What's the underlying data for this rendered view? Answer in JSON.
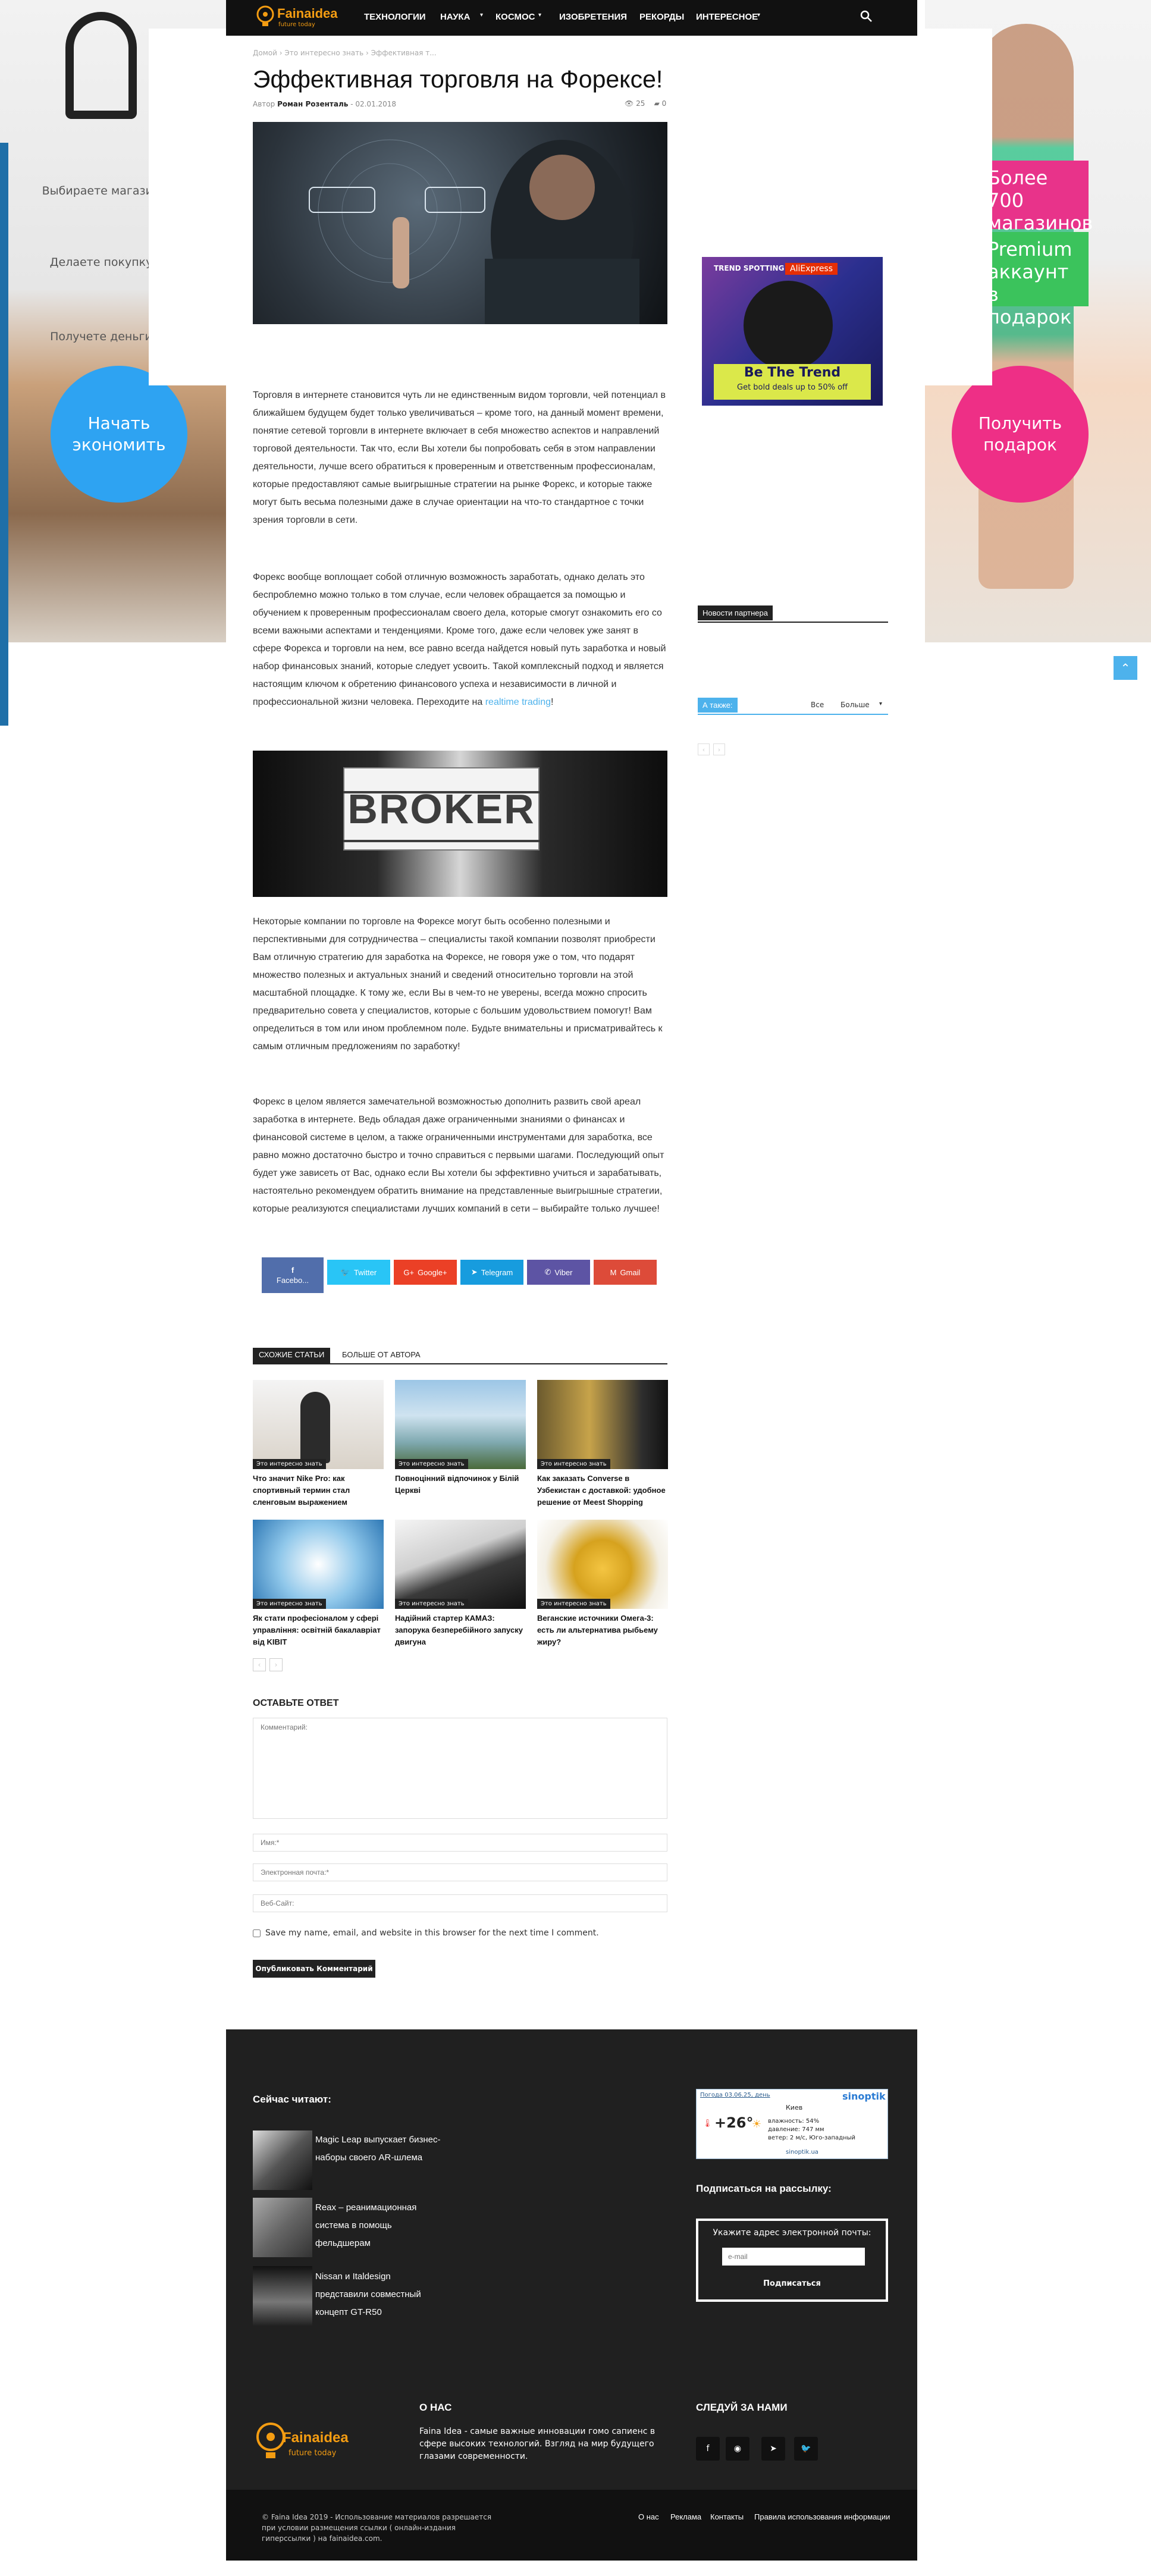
{
  "skin": {
    "left_steps": [
      "Выбираете магазин",
      "Делаете покупку",
      "Получете деньги"
    ],
    "left_button": "Начать экономить",
    "right_button": "Получить подарок",
    "right_promo_1": "Более 700 магазинов",
    "right_promo_2": "Premium аккаунт в подарок"
  },
  "nav": {
    "logo": "Fainaidea",
    "logo_sub": "future today",
    "items": [
      "ТЕХНОЛОГИИ",
      "НАУКА",
      "КОСМОС",
      "ИЗОБРЕТЕНИЯ",
      "РЕКОРДЫ",
      "ИНТЕРЕСНОЕ"
    ],
    "search_icon": "search-icon"
  },
  "article": {
    "breadcrumb": [
      "Домой",
      "Это интересно знать",
      "Эффективная т..."
    ],
    "title": "Эффективная торговля на Форексе!",
    "author_label": "Автор",
    "author": "Роман Розенталь",
    "date": "02.01.2018",
    "views": "25",
    "comments": "0",
    "p1": "Торговля в интернете становится чуть ли не единственным видом торговли, чей потенциал в ближайшем будущем будет только увеличиваться – кроме того, на данный момент времени, понятие сетевой торговли в интернете включает в себя множество аспектов и направлений торговой деятельности. Так что, если Вы хотели бы попробовать себя в этом направлении деятельности, лучше всего обратиться к проверенным и ответственным профессионалам, которые предоставляют самые выигрышные стратегии на рынке Форекс, и которые также могут быть весьма полезными даже в случае ориентации на что-то стандартное с точки зрения торговли в сети.",
    "p2": "Форекс вообще воплощает собой отличную возможность заработать, однако делать это беспроблемно можно только в том случае, если человек обращается за помощью и обучением к проверенным профессионалам своего дела, которые смогут ознакомить его со всеми важными аспектами и тенденциями. Кроме того, даже если человек уже занят в сфере Форекса и торговли на нем, все равно всегда найдется новый путь заработка и новый набор финансовых знаний, которые следует усвоить. Такой комплексный подход и является настоящим ключом к обретению финансового успеха и независимости в личной и профессиональной жизни человека. Переходите на",
    "p2_link": "realtime trading",
    "p2_end": "!",
    "broker_text": "BROKER",
    "p3": "Некоторые компании по торговле на Форексе могут быть особенно полезными и перспективными для сотрудничества – специалисты такой компании позволят приобрести Вам отличную стратегию для заработка на Форексе, не говоря уже о том, что подарят множество полезных и актуальных знаний и сведений относительно торговли на этой масштабной площадке. К тому же, если Вы в чем-то не уверены, всегда можно спросить предварительно совета у специалистов, которые с большим удовольствием помогут! Вам определиться в том или ином проблемном поле. Будьте внимательны и присматривайтесь к самым отличным предложениям по заработку!",
    "p4": "Форекс в целом является замечательной возможностью дополнить развить свой ареал заработка в интернете. Ведь обладая даже ограниченными знаниями о финансах и финансовой системе в целом, а также ограниченными инструментами для заработка, все равно можно достаточно быстро и точно справиться с первыми шагами. Последующий опыт будет уже зависеть от Вас, однако если Вы хотели бы эффективно учиться и зарабатывать, настоятельно рекомендуем обратить внимание на представленные выигрышные стратегии, которые реализуются специалистами лучших компаний в сети – выбирайте только лучшее!"
  },
  "share": [
    {
      "label": "Facebo...",
      "color": "#516eab"
    },
    {
      "label": "Twitter",
      "color": "#29c5f6"
    },
    {
      "label": "Google+",
      "color": "#eb4026"
    },
    {
      "label": "Telegram",
      "color": "#179cde"
    },
    {
      "label": "Viber",
      "color": "#5d54a4"
    },
    {
      "label": "Gmail",
      "color": "#dd4b39"
    }
  ],
  "related": {
    "tab_active": "СХОЖИЕ СТАТЬИ",
    "tab_other": "БОЛЬШЕ ОТ АВТОРА",
    "category": "Это интересно знать",
    "items": [
      "Что значит Nike Pro: как спортивный термин стал сленговым выражением",
      "Повноцінний відпочинок у Білій Церкві",
      "Как заказать Converse в Узбекистан с доставкой: удобное решение от Meest Shopping",
      "Як стати професіоналом у сфері управління: освітній бакалавріат від KIBIT",
      "Надійний стартер КАМАЗ: запорука безперебійного запуску двигуна",
      "Веганские источники Омега-3: есть ли альтернатива рыбьему жиру?"
    ]
  },
  "comment_form": {
    "title": "ОСТАВЬТЕ ОТВЕТ",
    "comment_placeholder": "Комментарий:",
    "name_placeholder": "Имя:*",
    "email_placeholder": "Электронная почта:*",
    "website_placeholder": "Веб-Сайт:",
    "save_info": "Save my name, email, and website in this browser for the next time I comment.",
    "submit": "Опубликовать Комментарий"
  },
  "sidebar": {
    "ad_brand": "AliExpress",
    "ad_tag": "TREND SPOTTING",
    "ad_headline": "Be The Trend",
    "ad_sub": "Get bold deals up to 50% off",
    "partner_news": "Новости партнера",
    "also": "А также:",
    "filter_all": "Все",
    "filter_more": "Больше"
  },
  "footer": {
    "reading_now": "Сейчас читают:",
    "posts": [
      "Magic Leap выпускает бизнес-наборы своего AR-шлема",
      "Reax – реанимационная система в помощь фельдшерам",
      "Nissan и Italdesign представили совместный концепт GT-R50"
    ],
    "weather_city": "Киев",
    "weather_temp": "+26°",
    "weather_brand": "sinoptik",
    "weather_date": "Погода 03.06.25, день",
    "weather_humidity": "влажность: 54%",
    "weather_pressure": "давление: 747 мм",
    "weather_wind": "ветер: 2 м/с, Юго-западный",
    "weather_site": "sinoptik.ua",
    "subscribe_title": "Подписаться на рассылку:",
    "subscribe_prompt": "Укажите адрес электронной почты:",
    "subscribe_placeholder": "e-mail",
    "subscribe_button": "Подписаться",
    "about_title": "О НАС",
    "about_text": "Faina Idea - самые важные инновации гомо сапиенс в сфере высоких технологий. Взгляд на мир будущего глазами современности.",
    "follow_title": "СЛЕДУЙ ЗА НАМИ",
    "copyright": "© Faina Idea 2019 - Использование материалов разрешается при условии размещения ссылки ( онлайн-издания гиперссылки ) на fainaidea.com.",
    "links": [
      "О нас",
      "Реклама",
      "Контакты",
      "Правила использования информации"
    ]
  }
}
